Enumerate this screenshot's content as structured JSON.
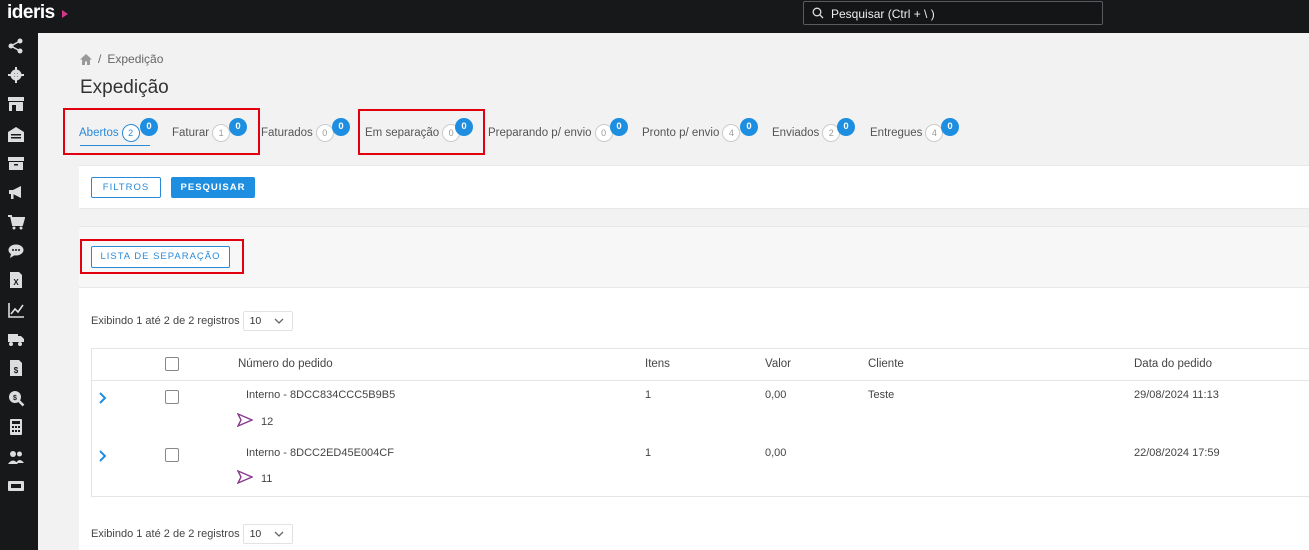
{
  "app": {
    "logo": "ideris",
    "search_placeholder": "Pesquisar (Ctrl + \\ )"
  },
  "sidebar": {
    "icons": [
      "share-icon",
      "gear-icon",
      "store-icon",
      "warehouse-icon",
      "archive-icon",
      "megaphone-icon",
      "cart-icon",
      "chat-icon",
      "excel-icon",
      "chart-icon",
      "truck-icon",
      "invoice-icon",
      "search-money-icon",
      "calculator-icon",
      "users-icon",
      "ticket-icon"
    ]
  },
  "breadcrumb": {
    "separator": "/",
    "current": "Expedição"
  },
  "page": {
    "title": "Expedição"
  },
  "tabs": [
    {
      "label": "Abertos",
      "count": "2",
      "badge": "0",
      "active": true
    },
    {
      "label": "Faturar",
      "count": "1",
      "badge": "0"
    },
    {
      "label": "Faturados",
      "count": "0",
      "badge": "0"
    },
    {
      "label": "Em separação",
      "count": "0",
      "badge": "0"
    },
    {
      "label": "Preparando p/ envio",
      "count": "0",
      "badge": "0"
    },
    {
      "label": "Pronto p/ envio",
      "count": "4",
      "badge": "0"
    },
    {
      "label": "Enviados",
      "count": "2",
      "badge": "0"
    },
    {
      "label": "Entregues",
      "count": "4",
      "badge": "0"
    }
  ],
  "filters": {
    "filtros_label": "FILTROS",
    "pesquisar_label": "PESQUISAR"
  },
  "actions": {
    "lista_separacao_label": "LISTA DE SEPARAÇÃO"
  },
  "pagination": {
    "info_top": "Exibindo 1 até 2 de 2 registros",
    "info_bottom": "Exibindo 1 até 2 de 2 registros",
    "page_size": "10"
  },
  "table": {
    "headers": {
      "pedido": "Número do pedido",
      "itens": "Itens",
      "valor": "Valor",
      "cliente": "Cliente",
      "data": "Data do pedido"
    },
    "rows": [
      {
        "pedido": "Interno - 8DCC834CCC5B9B5",
        "marketplace_number": "12",
        "itens": "1",
        "valor": "0,00",
        "cliente": "Teste",
        "data": "29/08/2024 11:13"
      },
      {
        "pedido": "Interno - 8DCC2ED45E004CF",
        "marketplace_number": "11",
        "itens": "1",
        "valor": "0,00",
        "cliente": "",
        "data": "22/08/2024 17:59"
      }
    ]
  },
  "colors": {
    "accent": "#1e8fe0",
    "highlight": "#e0000e",
    "topbar": "#17181a"
  }
}
